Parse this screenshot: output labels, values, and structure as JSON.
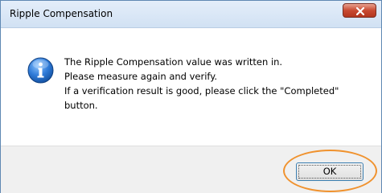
{
  "dialog": {
    "title": "Ripple Compensation",
    "close_icon": "close-icon",
    "message_icon": "info-icon",
    "message_lines": [
      "The Ripple Compensation value was written in.",
      "Please measure again and verify.",
      "If a verification result is good, please click the \"Completed\"",
      "button."
    ],
    "ok_label": "OK",
    "highlight_color": "#f0922e"
  }
}
